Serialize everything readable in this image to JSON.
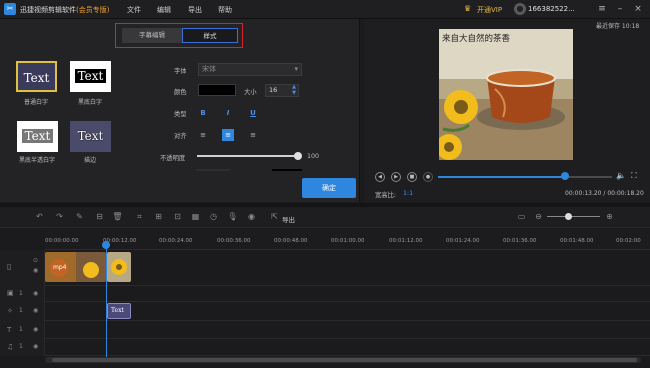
{
  "titlebar": {
    "app_title": "迅捷视频剪辑软件",
    "edition": "(会员专版)",
    "menus": [
      "文件",
      "编辑",
      "导出",
      "帮助"
    ],
    "vip_label": "开通VIP",
    "user_label": "166382522..."
  },
  "editor": {
    "tabs": [
      "字幕编辑",
      "样式"
    ],
    "active_tab": "样式",
    "presets": [
      {
        "sample": "Text",
        "label": "普通白字"
      },
      {
        "sample": "Text",
        "label": "黑底白字"
      },
      {
        "sample": "Text",
        "label": "黑底半透白字"
      },
      {
        "sample": "Text",
        "label": "描边"
      }
    ],
    "font_label": "字体",
    "font_value": "宋体",
    "color_label": "颜色",
    "size_label": "大小",
    "size_value": "16",
    "type_label": "类型",
    "type_buttons": [
      "B",
      "I",
      "U"
    ],
    "align_label": "对齐",
    "opacity_label": "不透明度",
    "opacity_value": "100",
    "opacity_fraction": 1.0,
    "ok_button": "确定"
  },
  "preview": {
    "last_saved": "最近保存 10:18",
    "overlay_text": "来自大自然的茶香",
    "aspect_label": "宽高比:",
    "aspect_value": "1:1",
    "timecode": "00:00:13.20 / 00:00:18.20",
    "progress_fraction": 0.72
  },
  "toolbar": {
    "export_label": "导出"
  },
  "timeline": {
    "ruler_ticks": [
      "00:00:00.00",
      "00:00:12.00",
      "00:00:24.00",
      "00:00:36.00",
      "00:00:48.00",
      "00:01:00.00",
      "00:01:12.00",
      "00:01:24.00",
      "00:01:36.00",
      "00:01:48.00",
      "00:02:00"
    ],
    "tracks": [
      {
        "label": "",
        "clip_text": "mp4"
      },
      {
        "label": "1",
        "clip_text": ""
      },
      {
        "label": "1",
        "clip_text": "Text"
      },
      {
        "label": "1",
        "clip_text": ""
      },
      {
        "label": "1",
        "clip_text": ""
      }
    ]
  },
  "colors": {
    "accent": "#2e86de",
    "highlight_box": "#d8232a",
    "vip": "#e8b84a"
  }
}
